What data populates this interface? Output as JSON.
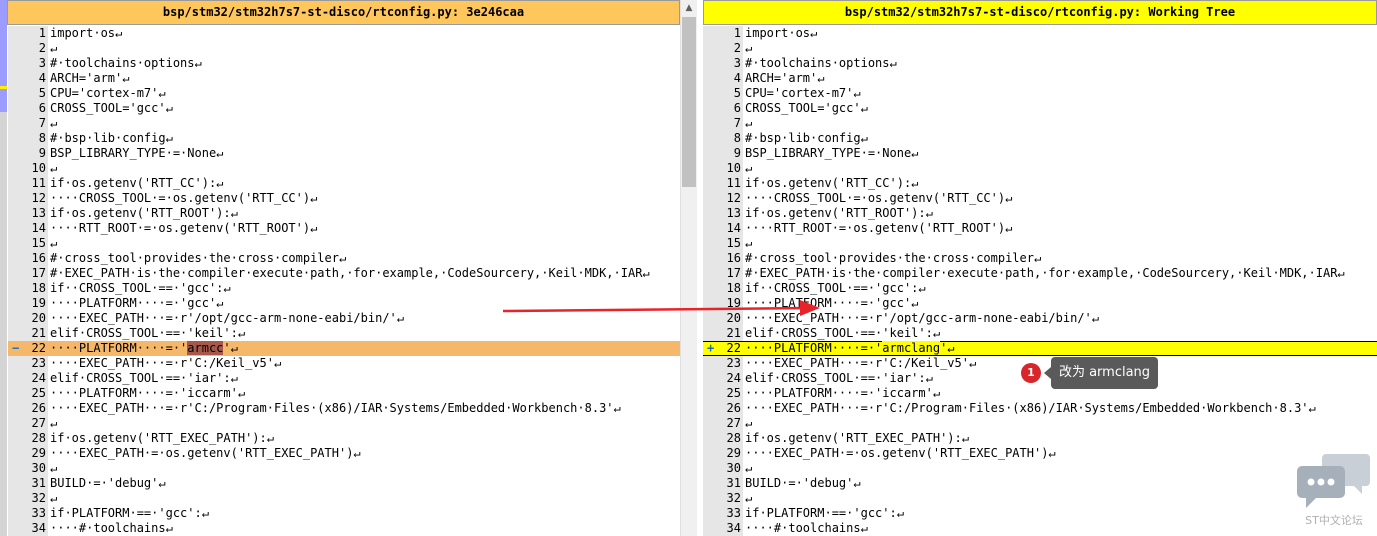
{
  "left": {
    "title": "bsp/stm32/stm32h7s7-st-disco/rtconfig.py: 3e246caa",
    "changed_marker": "−",
    "lines": [
      {
        "num": "1",
        "text": "import·os↵"
      },
      {
        "num": "2",
        "text": "↵"
      },
      {
        "num": "3",
        "text": "#·toolchains·options↵"
      },
      {
        "num": "4",
        "text": "ARCH='arm'↵"
      },
      {
        "num": "5",
        "text": "CPU='cortex-m7'↵"
      },
      {
        "num": "6",
        "text": "CROSS_TOOL='gcc'↵"
      },
      {
        "num": "7",
        "text": "↵"
      },
      {
        "num": "8",
        "text": "#·bsp·lib·config↵"
      },
      {
        "num": "9",
        "text": "BSP_LIBRARY_TYPE·=·None↵"
      },
      {
        "num": "10",
        "text": "↵"
      },
      {
        "num": "11",
        "text": "if·os.getenv('RTT_CC'):↵"
      },
      {
        "num": "12",
        "text": "····CROSS_TOOL·=·os.getenv('RTT_CC')↵"
      },
      {
        "num": "13",
        "text": "if·os.getenv('RTT_ROOT'):↵"
      },
      {
        "num": "14",
        "text": "····RTT_ROOT·=·os.getenv('RTT_ROOT')↵"
      },
      {
        "num": "15",
        "text": "↵"
      },
      {
        "num": "16",
        "text": "#·cross_tool·provides·the·cross·compiler↵"
      },
      {
        "num": "17",
        "text": "#·EXEC_PATH·is·the·compiler·execute·path,·for·example,·CodeSourcery,·Keil·MDK,·IAR↵"
      },
      {
        "num": "18",
        "text": "if··CROSS_TOOL·==·'gcc':↵"
      },
      {
        "num": "19",
        "text": "····PLATFORM····=·'gcc'↵"
      },
      {
        "num": "20",
        "text": "····EXEC_PATH···=·r'/opt/gcc-arm-none-eabi/bin/'↵"
      },
      {
        "num": "21",
        "text": "elif·CROSS_TOOL·==·'keil':↵"
      },
      {
        "num": "22",
        "pre": "····PLATFORM····=·'",
        "hl": "armcc",
        "post": "'↵"
      },
      {
        "num": "23",
        "text": "····EXEC_PATH···=·r'C:/Keil_v5'↵"
      },
      {
        "num": "24",
        "text": "elif·CROSS_TOOL·==·'iar':↵"
      },
      {
        "num": "25",
        "text": "····PLATFORM····=·'iccarm'↵"
      },
      {
        "num": "26",
        "text": "····EXEC_PATH···=·r'C:/Program·Files·(x86)/IAR·Systems/Embedded·Workbench·8.3'↵"
      },
      {
        "num": "27",
        "text": "↵"
      },
      {
        "num": "28",
        "text": "if·os.getenv('RTT_EXEC_PATH'):↵"
      },
      {
        "num": "29",
        "text": "····EXEC_PATH·=·os.getenv('RTT_EXEC_PATH')↵"
      },
      {
        "num": "30",
        "text": "↵"
      },
      {
        "num": "31",
        "text": "BUILD·=·'debug'↵"
      },
      {
        "num": "32",
        "text": "↵"
      },
      {
        "num": "33",
        "text": "if·PLATFORM·==·'gcc':↵"
      },
      {
        "num": "34",
        "text": "····#·toolchains↵"
      }
    ]
  },
  "right": {
    "title": "bsp/stm32/stm32h7s7-st-disco/rtconfig.py: Working Tree",
    "changed_marker": "+",
    "lines": [
      {
        "num": "1",
        "text": "import·os↵"
      },
      {
        "num": "2",
        "text": "↵"
      },
      {
        "num": "3",
        "text": "#·toolchains·options↵"
      },
      {
        "num": "4",
        "text": "ARCH='arm'↵"
      },
      {
        "num": "5",
        "text": "CPU='cortex-m7'↵"
      },
      {
        "num": "6",
        "text": "CROSS_TOOL='gcc'↵"
      },
      {
        "num": "7",
        "text": "↵"
      },
      {
        "num": "8",
        "text": "#·bsp·lib·config↵"
      },
      {
        "num": "9",
        "text": "BSP_LIBRARY_TYPE·=·None↵"
      },
      {
        "num": "10",
        "text": "↵"
      },
      {
        "num": "11",
        "text": "if·os.getenv('RTT_CC'):↵"
      },
      {
        "num": "12",
        "text": "····CROSS_TOOL·=·os.getenv('RTT_CC')↵"
      },
      {
        "num": "13",
        "text": "if·os.getenv('RTT_ROOT'):↵"
      },
      {
        "num": "14",
        "text": "····RTT_ROOT·=·os.getenv('RTT_ROOT')↵"
      },
      {
        "num": "15",
        "text": "↵"
      },
      {
        "num": "16",
        "text": "#·cross_tool·provides·the·cross·compiler↵"
      },
      {
        "num": "17",
        "text": "#·EXEC_PATH·is·the·compiler·execute·path,·for·example,·CodeSourcery,·Keil·MDK,·IAR↵"
      },
      {
        "num": "18",
        "text": "if··CROSS_TOOL·==·'gcc':↵"
      },
      {
        "num": "19",
        "text": "····PLATFORM····=·'gcc'↵"
      },
      {
        "num": "20",
        "text": "····EXEC_PATH···=·r'/opt/gcc-arm-none-eabi/bin/'↵"
      },
      {
        "num": "21",
        "text": "elif·CROSS_TOOL·==·'keil':↵"
      },
      {
        "num": "22",
        "pre": "····PLATFORM····=·'",
        "hl": "armclang",
        "post": "'↵"
      },
      {
        "num": "23",
        "text": "····EXEC_PATH···=·r'C:/Keil_v5'↵"
      },
      {
        "num": "24",
        "text": "elif·CROSS_TOOL·==·'iar':↵"
      },
      {
        "num": "25",
        "text": "····PLATFORM····=·'iccarm'↵"
      },
      {
        "num": "26",
        "text": "····EXEC_PATH···=·r'C:/Program·Files·(x86)/IAR·Systems/Embedded·Workbench·8.3'↵"
      },
      {
        "num": "27",
        "text": "↵"
      },
      {
        "num": "28",
        "text": "if·os.getenv('RTT_EXEC_PATH'):↵"
      },
      {
        "num": "29",
        "text": "····EXEC_PATH·=·os.getenv('RTT_EXEC_PATH')↵"
      },
      {
        "num": "30",
        "text": "↵"
      },
      {
        "num": "31",
        "text": "BUILD·=·'debug'↵"
      },
      {
        "num": "32",
        "text": "↵"
      },
      {
        "num": "33",
        "text": "if·PLATFORM·==·'gcc':↵"
      },
      {
        "num": "34",
        "text": "····#·toolchains↵"
      }
    ]
  },
  "annotation": {
    "number": "1",
    "text": "改为 armclang",
    "arrow_color": "#e8232a"
  },
  "watermark": {
    "text": "ST中文论坛",
    "icon": "chat-bubbles-icon"
  },
  "scrollbar": {
    "up_glyph": "▲"
  },
  "colors": {
    "left_header": "#ffc65c",
    "right_header": "#ffff00",
    "left_changed": "#f5b86a",
    "right_changed": "#ffff00",
    "marker": "#1570b8"
  }
}
